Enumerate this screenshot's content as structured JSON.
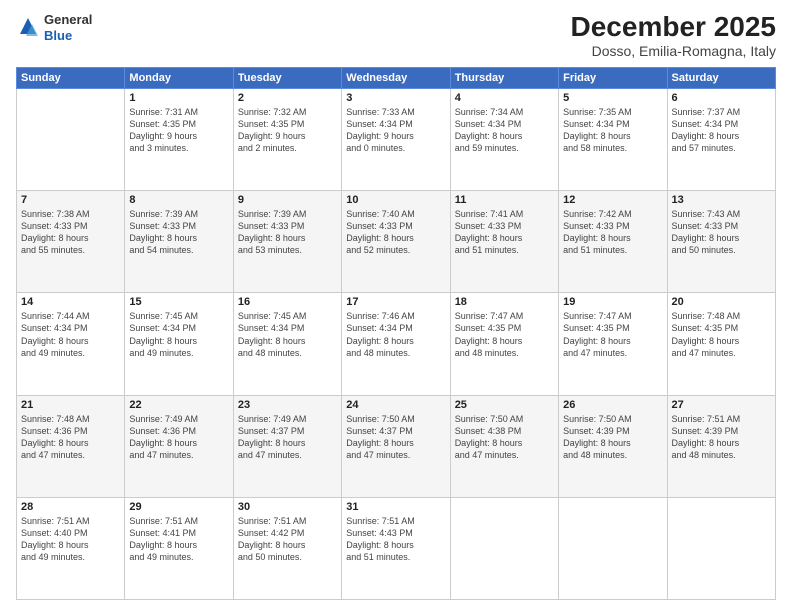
{
  "header": {
    "logo": {
      "line1": "General",
      "line2": "Blue"
    },
    "title": "December 2025",
    "subtitle": "Dosso, Emilia-Romagna, Italy"
  },
  "days_header": [
    "Sunday",
    "Monday",
    "Tuesday",
    "Wednesday",
    "Thursday",
    "Friday",
    "Saturday"
  ],
  "weeks": [
    [
      {
        "day": "",
        "detail": ""
      },
      {
        "day": "1",
        "detail": "Sunrise: 7:31 AM\nSunset: 4:35 PM\nDaylight: 9 hours\nand 3 minutes."
      },
      {
        "day": "2",
        "detail": "Sunrise: 7:32 AM\nSunset: 4:35 PM\nDaylight: 9 hours\nand 2 minutes."
      },
      {
        "day": "3",
        "detail": "Sunrise: 7:33 AM\nSunset: 4:34 PM\nDaylight: 9 hours\nand 0 minutes."
      },
      {
        "day": "4",
        "detail": "Sunrise: 7:34 AM\nSunset: 4:34 PM\nDaylight: 8 hours\nand 59 minutes."
      },
      {
        "day": "5",
        "detail": "Sunrise: 7:35 AM\nSunset: 4:34 PM\nDaylight: 8 hours\nand 58 minutes."
      },
      {
        "day": "6",
        "detail": "Sunrise: 7:37 AM\nSunset: 4:34 PM\nDaylight: 8 hours\nand 57 minutes."
      }
    ],
    [
      {
        "day": "7",
        "detail": "Sunrise: 7:38 AM\nSunset: 4:33 PM\nDaylight: 8 hours\nand 55 minutes."
      },
      {
        "day": "8",
        "detail": "Sunrise: 7:39 AM\nSunset: 4:33 PM\nDaylight: 8 hours\nand 54 minutes."
      },
      {
        "day": "9",
        "detail": "Sunrise: 7:39 AM\nSunset: 4:33 PM\nDaylight: 8 hours\nand 53 minutes."
      },
      {
        "day": "10",
        "detail": "Sunrise: 7:40 AM\nSunset: 4:33 PM\nDaylight: 8 hours\nand 52 minutes."
      },
      {
        "day": "11",
        "detail": "Sunrise: 7:41 AM\nSunset: 4:33 PM\nDaylight: 8 hours\nand 51 minutes."
      },
      {
        "day": "12",
        "detail": "Sunrise: 7:42 AM\nSunset: 4:33 PM\nDaylight: 8 hours\nand 51 minutes."
      },
      {
        "day": "13",
        "detail": "Sunrise: 7:43 AM\nSunset: 4:33 PM\nDaylight: 8 hours\nand 50 minutes."
      }
    ],
    [
      {
        "day": "14",
        "detail": "Sunrise: 7:44 AM\nSunset: 4:34 PM\nDaylight: 8 hours\nand 49 minutes."
      },
      {
        "day": "15",
        "detail": "Sunrise: 7:45 AM\nSunset: 4:34 PM\nDaylight: 8 hours\nand 49 minutes."
      },
      {
        "day": "16",
        "detail": "Sunrise: 7:45 AM\nSunset: 4:34 PM\nDaylight: 8 hours\nand 48 minutes."
      },
      {
        "day": "17",
        "detail": "Sunrise: 7:46 AM\nSunset: 4:34 PM\nDaylight: 8 hours\nand 48 minutes."
      },
      {
        "day": "18",
        "detail": "Sunrise: 7:47 AM\nSunset: 4:35 PM\nDaylight: 8 hours\nand 48 minutes."
      },
      {
        "day": "19",
        "detail": "Sunrise: 7:47 AM\nSunset: 4:35 PM\nDaylight: 8 hours\nand 47 minutes."
      },
      {
        "day": "20",
        "detail": "Sunrise: 7:48 AM\nSunset: 4:35 PM\nDaylight: 8 hours\nand 47 minutes."
      }
    ],
    [
      {
        "day": "21",
        "detail": "Sunrise: 7:48 AM\nSunset: 4:36 PM\nDaylight: 8 hours\nand 47 minutes."
      },
      {
        "day": "22",
        "detail": "Sunrise: 7:49 AM\nSunset: 4:36 PM\nDaylight: 8 hours\nand 47 minutes."
      },
      {
        "day": "23",
        "detail": "Sunrise: 7:49 AM\nSunset: 4:37 PM\nDaylight: 8 hours\nand 47 minutes."
      },
      {
        "day": "24",
        "detail": "Sunrise: 7:50 AM\nSunset: 4:37 PM\nDaylight: 8 hours\nand 47 minutes."
      },
      {
        "day": "25",
        "detail": "Sunrise: 7:50 AM\nSunset: 4:38 PM\nDaylight: 8 hours\nand 47 minutes."
      },
      {
        "day": "26",
        "detail": "Sunrise: 7:50 AM\nSunset: 4:39 PM\nDaylight: 8 hours\nand 48 minutes."
      },
      {
        "day": "27",
        "detail": "Sunrise: 7:51 AM\nSunset: 4:39 PM\nDaylight: 8 hours\nand 48 minutes."
      }
    ],
    [
      {
        "day": "28",
        "detail": "Sunrise: 7:51 AM\nSunset: 4:40 PM\nDaylight: 8 hours\nand 49 minutes."
      },
      {
        "day": "29",
        "detail": "Sunrise: 7:51 AM\nSunset: 4:41 PM\nDaylight: 8 hours\nand 49 minutes."
      },
      {
        "day": "30",
        "detail": "Sunrise: 7:51 AM\nSunset: 4:42 PM\nDaylight: 8 hours\nand 50 minutes."
      },
      {
        "day": "31",
        "detail": "Sunrise: 7:51 AM\nSunset: 4:43 PM\nDaylight: 8 hours\nand 51 minutes."
      },
      {
        "day": "",
        "detail": ""
      },
      {
        "day": "",
        "detail": ""
      },
      {
        "day": "",
        "detail": ""
      }
    ]
  ]
}
